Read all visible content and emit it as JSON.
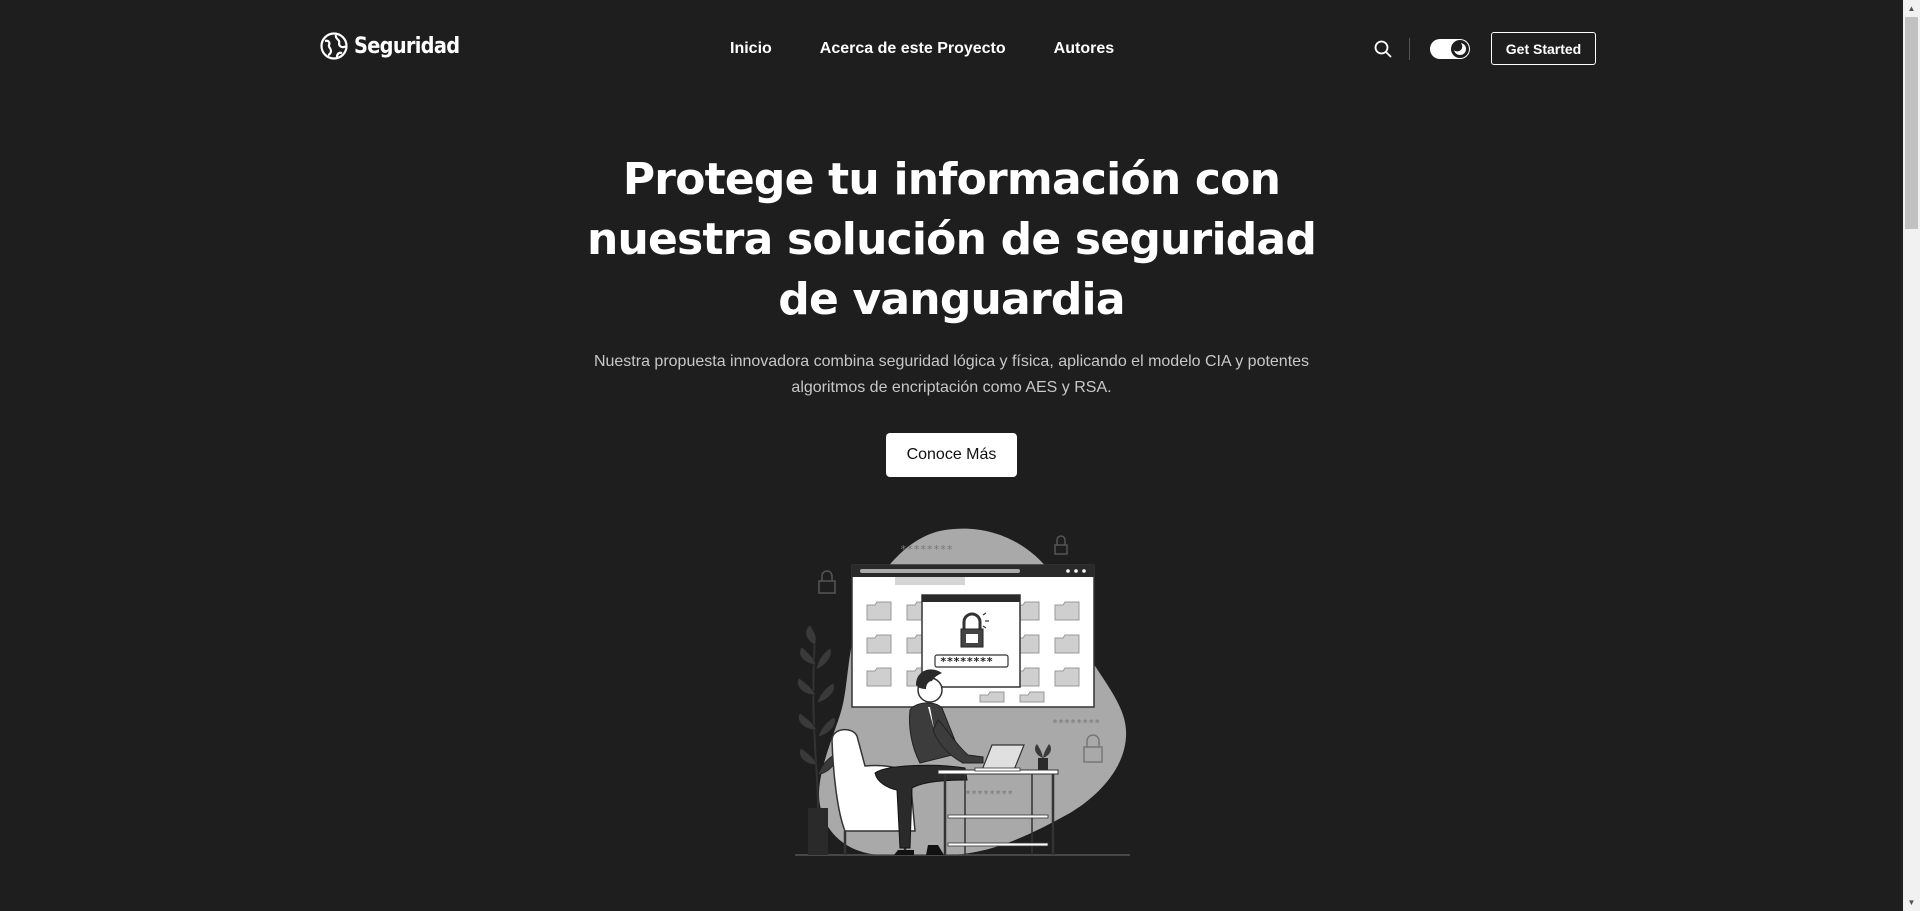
{
  "header": {
    "brand": "Seguridad",
    "nav": [
      {
        "label": "Inicio"
      },
      {
        "label": "Acerca de este Proyecto"
      },
      {
        "label": "Autores"
      }
    ],
    "search_icon": "search-icon",
    "theme_toggle": {
      "state": "dark",
      "icon": "moon-icon"
    },
    "cta_label": "Get Started"
  },
  "hero": {
    "title": "Protege tu información con nuestra solución de seguridad de vanguardia",
    "subtitle": "Nuestra propuesta innovadora combina seguridad lógica y física, aplicando el modelo CIA y potentes algoritmos de encriptación como AES y RSA.",
    "button_label": "Conoce Más",
    "illustration": {
      "password_mask_top": "********",
      "password_mask_field": "********",
      "password_mask_right": "********",
      "password_mask_desk": "********"
    }
  },
  "colors": {
    "background": "#1e1e1e",
    "text": "#ffffff",
    "muted_text": "#c8c8c8",
    "button_bg": "#ffffff",
    "illustration_blob": "#a9a9a9"
  }
}
